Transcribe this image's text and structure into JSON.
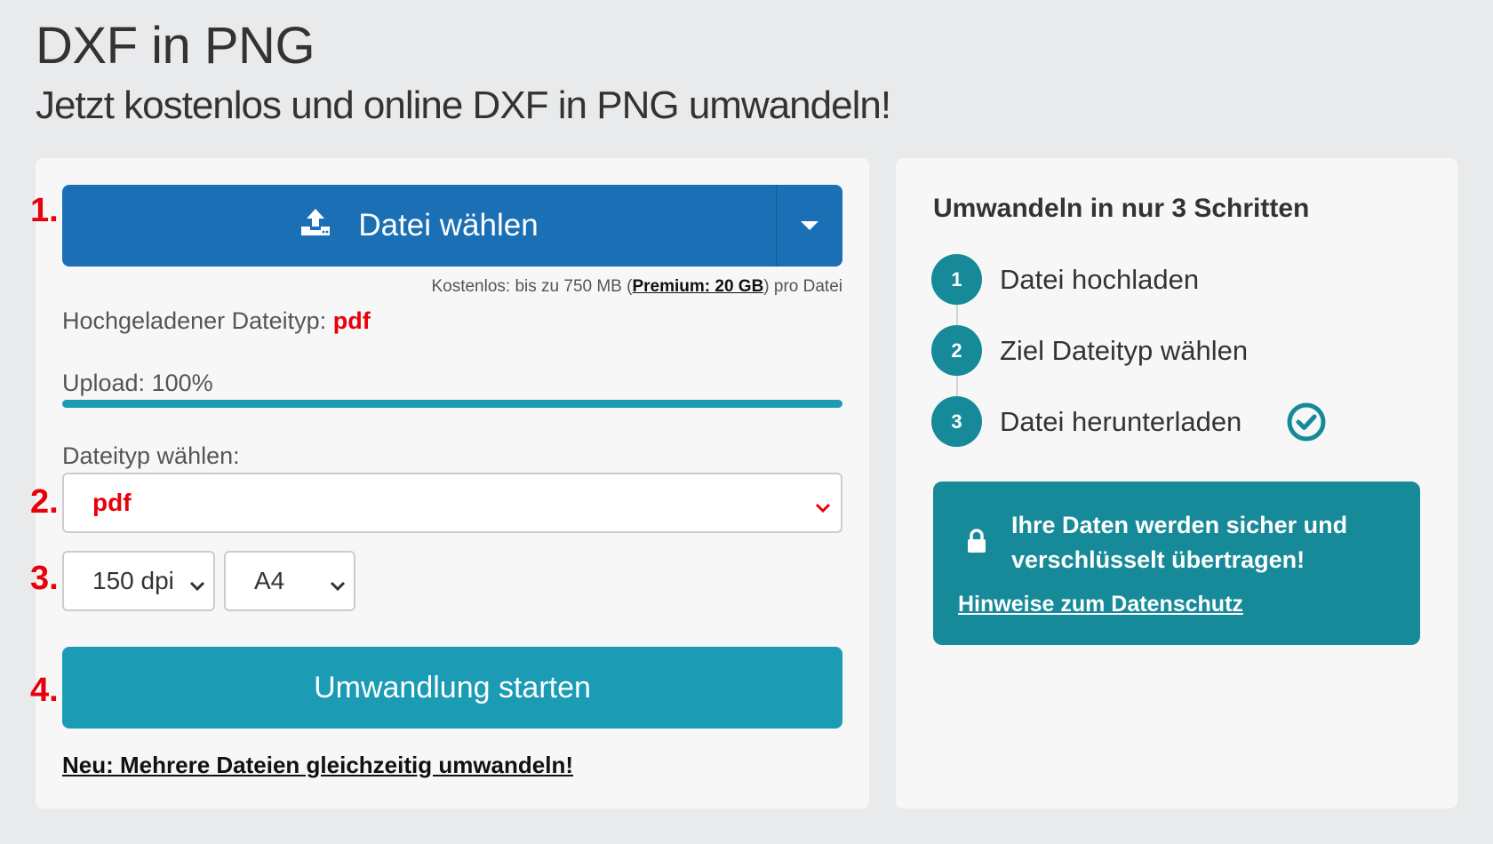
{
  "header": {
    "title": "DXF in PNG",
    "subtitle": "Jetzt kostenlos und online DXF in PNG umwandeln!"
  },
  "steps_numbers": [
    "1.",
    "2.",
    "3.",
    "4."
  ],
  "upload": {
    "button_label": "Datei wählen",
    "icon": "upload-icon",
    "limit_prefix": "Kostenlos: bis zu 750 MB (",
    "limit_premium": "Premium: 20 GB",
    "limit_suffix": ") pro Datei",
    "detected_label": "Hochgeladener Dateityp:",
    "detected_value": "pdf",
    "progress_label": "Upload: 100%",
    "progress_percent": 100
  },
  "format": {
    "label": "Dateityp wählen:",
    "selected": "pdf",
    "dpi_selected": "150 dpi",
    "page_selected": "A4"
  },
  "start_button": "Umwandlung starten",
  "batch_link": "Neu: Mehrere Dateien gleichzeitig umwandeln!",
  "sidebar": {
    "title": "Umwandeln in nur 3 Schritten",
    "steps": [
      {
        "num": "1",
        "label": "Datei hochladen"
      },
      {
        "num": "2",
        "label": "Ziel Dateityp wählen"
      },
      {
        "num": "3",
        "label": "Datei herunterladen"
      }
    ],
    "secure_text": "Ihre Daten werden sicher und verschlüsselt übertragen!",
    "privacy_link": "Hinweise zum Datenschutz"
  },
  "colors": {
    "primary_blue": "#1a6fb5",
    "teal": "#1b9bb4",
    "dark_teal": "#168a99",
    "accent_red": "#e8000b"
  }
}
